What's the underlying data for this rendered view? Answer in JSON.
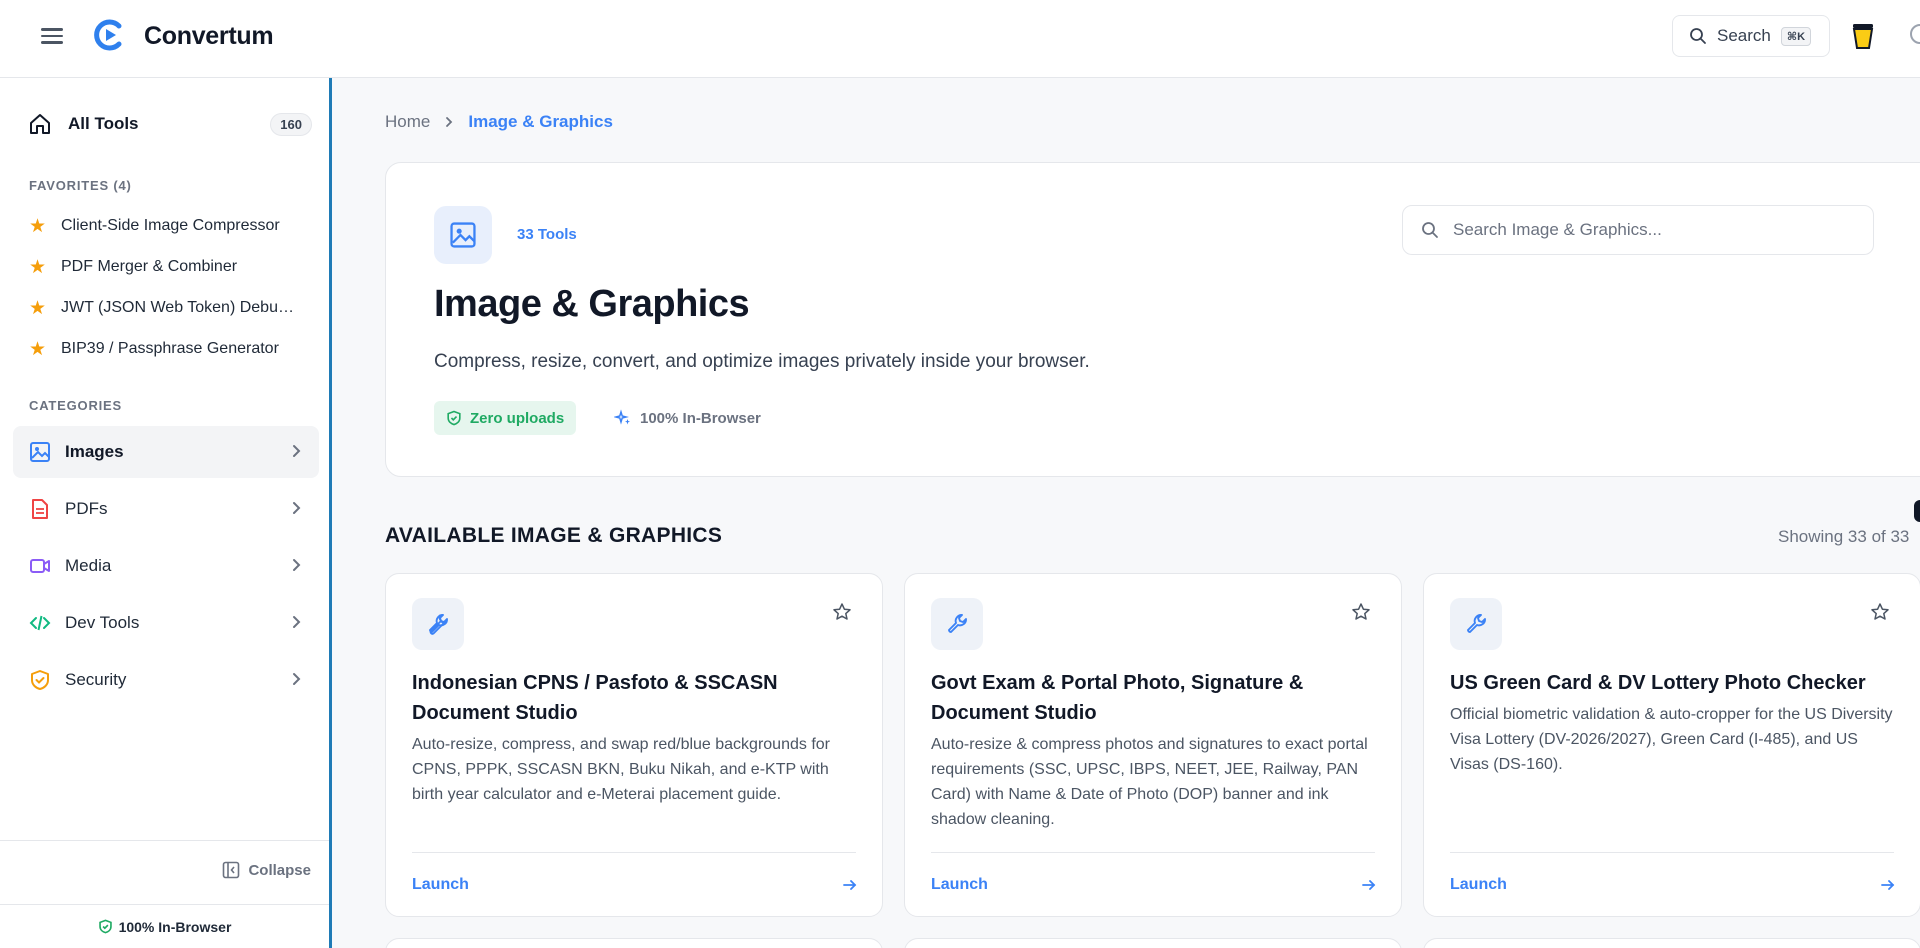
{
  "header": {
    "brand": "Convertum",
    "search_label": "Search",
    "search_shortcut": "⌘K"
  },
  "sidebar": {
    "all_tools_label": "All Tools",
    "all_tools_count": "160",
    "favorites_heading": "FAVORITES (4)",
    "favorites": [
      "Client-Side Image Compressor",
      "PDF Merger & Combiner",
      "JWT (JSON Web Token) Debugger",
      "BIP39 / Passphrase Generator"
    ],
    "categories_heading": "CATEGORIES",
    "categories": [
      {
        "label": "Images",
        "active": true
      },
      {
        "label": "PDFs",
        "active": false
      },
      {
        "label": "Media",
        "active": false
      },
      {
        "label": "Dev Tools",
        "active": false
      },
      {
        "label": "Security",
        "active": false
      }
    ],
    "collapse_label": "Collapse",
    "footer_label": "100% In-Browser"
  },
  "breadcrumb": {
    "home": "Home",
    "current": "Image & Graphics"
  },
  "hero": {
    "tools_count": "33 Tools",
    "title": "Image & Graphics",
    "subtitle": "Compress, resize, convert, and optimize images privately inside your browser.",
    "badge_zero": "Zero uploads",
    "badge_browser": "100% In-Browser",
    "search_placeholder": "Search Image & Graphics..."
  },
  "listing": {
    "heading": "AVAILABLE IMAGE & GRAPHICS",
    "showing": "Showing 33 of 33"
  },
  "cards": [
    {
      "title": "Indonesian CPNS / Pasfoto & SSCASN Document Studio",
      "description": "Auto-resize, compress, and swap red/blue backgrounds for CPNS, PPPK, SSCASN BKN, Buku Nikah, and e-KTP with birth year calculator and e-Meterai placement guide.",
      "launch": "Launch"
    },
    {
      "title": "Govt Exam & Portal Photo, Signature & Document Studio",
      "description": "Auto-resize & compress photos and signatures to exact portal requirements (SSC, UPSC, IBPS, NEET, JEE, Railway, PAN Card) with Name & Date of Photo (DOP) banner and ink shadow cleaning.",
      "launch": "Launch"
    },
    {
      "title": "US Green Card & DV Lottery Photo Checker",
      "description": "Official biometric validation & auto-cropper for the US Diversity Visa Lottery (DV-2026/2027), Green Card (I-485), and US Visas (DS-160).",
      "launch": "Launch"
    }
  ],
  "colors": {
    "accent": "#3b82f6",
    "sidebar_border": "#1f7bb6",
    "favorite_star": "#f59e0b",
    "success": "#1faa63"
  }
}
